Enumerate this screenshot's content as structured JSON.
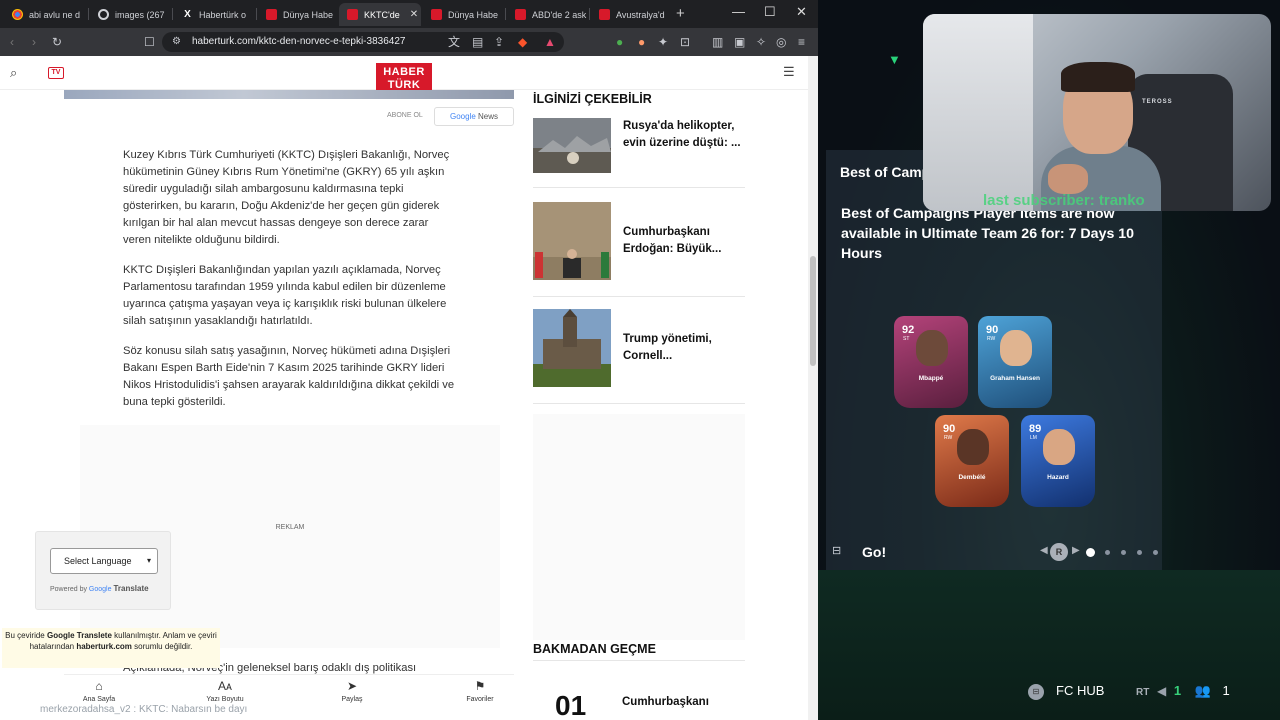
{
  "tabs": [
    {
      "label": "abi avlu ne d",
      "icon": "google-icon",
      "active": false
    },
    {
      "label": "images (267",
      "icon": "chrome-icon",
      "active": false
    },
    {
      "label": "Habertürk o",
      "icon": "x-icon",
      "active": false
    },
    {
      "label": "Dünya Habe",
      "icon": "haberturk-icon",
      "active": false
    },
    {
      "label": "KKTC'de",
      "icon": "haberturk-icon",
      "active": true
    },
    {
      "label": "Dünya Habe",
      "icon": "haberturk-icon",
      "active": false
    },
    {
      "label": "ABD'de 2 ask",
      "icon": "haberturk-icon",
      "active": false
    },
    {
      "label": "Avustralya'd",
      "icon": "haberturk-icon",
      "active": false
    }
  ],
  "url": "haberturk.com/kktc-den-norvec-e-tepki-3836427",
  "site": {
    "logo_top": "HABER",
    "logo_bottom": "TÜRK",
    "tv_label": "TV"
  },
  "article": {
    "follow_label": "ABONE OL",
    "gnews_google": "Google",
    "gnews_news": "News",
    "paragraphs": [
      "Kuzey Kıbrıs Türk Cumhuriyeti (KKTC) Dışişleri Bakanlığı, Norveç hükümetinin Güney Kıbrıs Rum Yönetimi'ne (GKRY) 65 yılı aşkın süredir uyguladığı silah ambargosunu kaldırmasına tepki gösterirken, bu kararın, Doğu Akdeniz'de her geçen gün giderek kırılgan bir hal alan mevcut hassas dengeye son derece zarar veren nitelikte olduğunu bildirdi.",
      "KKTC Dışişleri Bakanlığından yapılan yazılı açıklamada, Norveç Parlamentosu tarafından 1959 yılında kabul edilen bir düzenleme uyarınca çatışma yaşayan veya iç karışıklık riski bulunan ülkelere silah satışının yasaklandığı hatırlatıldı.",
      "Söz konusu silah satış yasağının, Norveç hükümeti adına Dışişleri Bakanı Espen Barth Eide'nin 7 Kasım 2025 tarihinde GKRY lideri Nikos Hristodulidis'i şahsen arayarak kaldırıldığına dikkat çekildi ve buna tepki gösterildi."
    ],
    "ad_label": "REKLAM",
    "cut_text": "Açıklamada, Norveç'in geleneksel barış odaklı dış politikası"
  },
  "sidebar": {
    "title": "İLGİNİZİ ÇEKEBİLİR",
    "items": [
      {
        "caption": "Rusya'da helikopter, evin üzerine düştü: ..."
      },
      {
        "caption": "Cumhurbaşkanı Erdoğan: Büyük..."
      },
      {
        "caption": "Trump yönetimi, Cornell..."
      }
    ],
    "section2_title": "BAKMADAN GEÇME",
    "big_number": "01",
    "bottom_caption": "Cumhurbaşkanı"
  },
  "translate": {
    "select_label": "Select Language",
    "powered_by": "Powered by",
    "google": "Google",
    "translate": "Translate",
    "notice_1": "Bu çeviride",
    "notice_bold1": "Google Translete",
    "notice_2": "kullanılmıştır. Anlam ve çeviri hatalarından",
    "notice_bold2": "haberturk.com",
    "notice_3": "sorumlu değildir."
  },
  "bottom_nav": [
    {
      "label": "Ana Sayfa",
      "icon": "home-icon"
    },
    {
      "label": "Yazı Boyutu",
      "icon": "font-size-icon"
    },
    {
      "label": "Paylaş",
      "icon": "share-icon"
    },
    {
      "label": "Favoriler",
      "icon": "bookmark-icon"
    }
  ],
  "ticker": "merkezoradahsa_v2 : KKTC: Nabarsın be dayı",
  "game": {
    "panel_title": "Best of Camp",
    "message": "Best of Campaigns Player Items are now available in Ultimate Team 26 for: 7 Days 10 Hours",
    "players": [
      {
        "name": "Mbappé",
        "rating": "92",
        "pos": "ST",
        "color": "#8a2e4e"
      },
      {
        "name": "Graham Hansen",
        "rating": "90",
        "pos": "RW",
        "color": "#2f6f9c"
      },
      {
        "name": "Dembélé",
        "rating": "90",
        "pos": "RW",
        "color": "#b5522f"
      },
      {
        "name": "Hazard",
        "rating": "89",
        "pos": "LM",
        "color": "#1d4fa8"
      }
    ],
    "go_label": "Go!",
    "r_label": "R",
    "hub_label": "FC HUB",
    "rt_label": "RT",
    "count_a": "1",
    "count_b": "1"
  },
  "webcam": {
    "chair_brand": "TEROSS",
    "overlay": "last subscriber: tranko"
  }
}
